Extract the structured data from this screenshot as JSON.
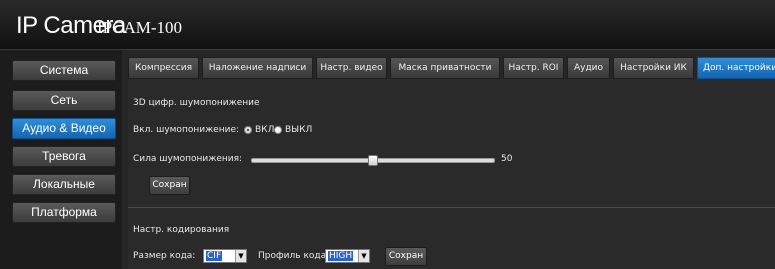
{
  "header": {
    "brand": "IP Camera",
    "model": "IPCAM-100"
  },
  "sidebar": {
    "items": [
      {
        "label": "Система"
      },
      {
        "label": "Сеть"
      },
      {
        "label": "Аудио & Видео",
        "active": true
      },
      {
        "label": "Тревога"
      },
      {
        "label": "Локальные"
      },
      {
        "label": "Платформа"
      }
    ]
  },
  "tabs": [
    {
      "label": "Компрессия"
    },
    {
      "label": "Наложение надписи"
    },
    {
      "label": "Настр. видео"
    },
    {
      "label": "Маска приватности"
    },
    {
      "label": "Настр. ROI"
    },
    {
      "label": "Аудио"
    },
    {
      "label": "Настройки ИК"
    },
    {
      "label": "Доп. настройки",
      "active": true
    }
  ],
  "noise": {
    "section_title": "3D цифр. шумопонижение",
    "enable_label": "Вкл. шумопонижение:",
    "option_on": "ВКЛ",
    "option_off": "ВЫКЛ",
    "selected": "ВКЛ",
    "strength_label": "Сила шумопонижения:",
    "strength_value": "50",
    "strength_fraction": 0.5,
    "save_label": "Сохран"
  },
  "encoding": {
    "section_title": "Настр. кодирования",
    "size_label": "Размер кода:",
    "size_value": "CIF",
    "profile_label": "Профиль кода:",
    "profile_value": "HIGH",
    "save_label": "Сохран"
  },
  "colors": {
    "accent": "#1e7bc8",
    "background": "#262626"
  }
}
